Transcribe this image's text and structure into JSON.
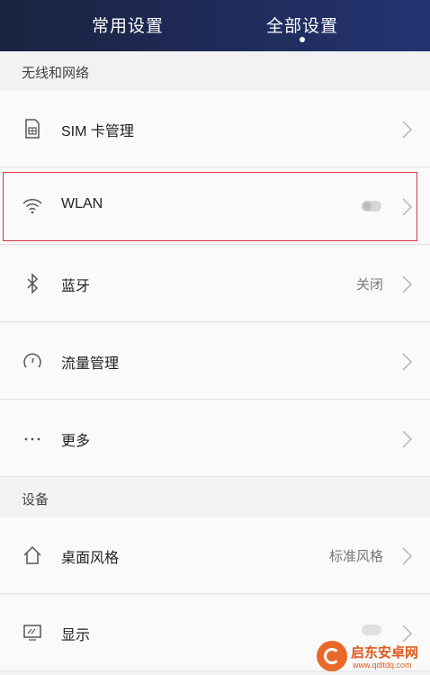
{
  "header": {
    "tabs": [
      {
        "label": "常用设置",
        "selected": false
      },
      {
        "label": "全部设置",
        "selected": true
      }
    ]
  },
  "sections": [
    {
      "title": "无线和网络",
      "items": [
        {
          "label": "SIM 卡管理",
          "value": "",
          "icon": "sim-card-icon"
        },
        {
          "label": "WLAN",
          "value": "",
          "icon": "wifi-icon",
          "toggle": "off"
        },
        {
          "label": "蓝牙",
          "value": "关闭",
          "icon": "bluetooth-icon"
        },
        {
          "label": "流量管理",
          "value": "",
          "icon": "gauge-icon"
        },
        {
          "label": "更多",
          "value": "",
          "icon": "more-dots-icon"
        }
      ]
    },
    {
      "title": "设备",
      "items": [
        {
          "label": "桌面风格",
          "value": "标准风格",
          "icon": "home-icon"
        },
        {
          "label": "显示",
          "value": "",
          "icon": "display-icon"
        }
      ]
    }
  ],
  "watermark": {
    "title": "启东安卓网",
    "url": "www.qdltdq.com"
  },
  "colors": {
    "header_start": "#1a2340",
    "header_end": "#243371",
    "highlight_border": "#d9363e",
    "watermark": "#e05a1f"
  }
}
